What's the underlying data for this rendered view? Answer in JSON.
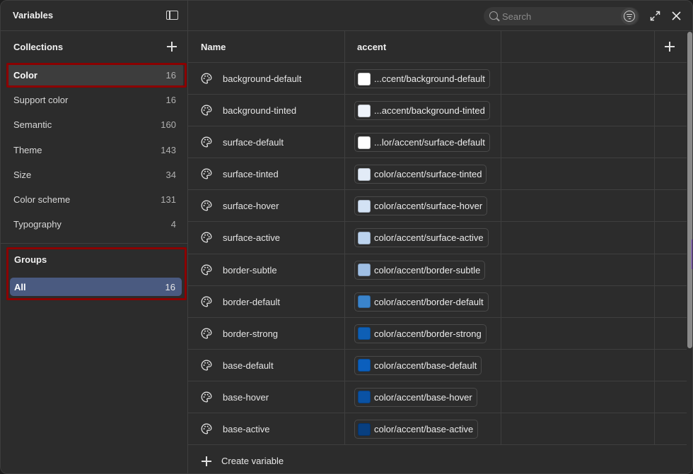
{
  "window": {
    "title": "Variables"
  },
  "sidebar": {
    "collections_heading": "Collections",
    "collections": [
      {
        "label": "Color",
        "count": "16",
        "selected": true
      },
      {
        "label": "Support color",
        "count": "16"
      },
      {
        "label": "Semantic",
        "count": "160"
      },
      {
        "label": "Theme",
        "count": "143"
      },
      {
        "label": "Size",
        "count": "34"
      },
      {
        "label": "Color scheme",
        "count": "131"
      },
      {
        "label": "Typography",
        "count": "4"
      }
    ],
    "groups_heading": "Groups",
    "groups": [
      {
        "label": "All",
        "count": "16",
        "selected": true
      }
    ]
  },
  "search": {
    "placeholder": "Search"
  },
  "table": {
    "columns": {
      "name": "Name",
      "mode": "accent"
    },
    "rows": [
      {
        "name": "background-default",
        "value": "...ccent/background-default",
        "color": "#ffffff"
      },
      {
        "name": "background-tinted",
        "value": "...accent/background-tinted",
        "color": "#eef3fa"
      },
      {
        "name": "surface-default",
        "value": "...lor/accent/surface-default",
        "color": "#ffffff"
      },
      {
        "name": "surface-tinted",
        "value": "color/accent/surface-tinted",
        "color": "#e2ebf7"
      },
      {
        "name": "surface-hover",
        "value": "color/accent/surface-hover",
        "color": "#d3e2f4"
      },
      {
        "name": "surface-active",
        "value": "color/accent/surface-active",
        "color": "#bcd3ee"
      },
      {
        "name": "border-subtle",
        "value": "color/accent/border-subtle",
        "color": "#9fbfe4"
      },
      {
        "name": "border-default",
        "value": "color/accent/border-default",
        "color": "#3a84cc"
      },
      {
        "name": "border-strong",
        "value": "color/accent/border-strong",
        "color": "#0e5fb5"
      },
      {
        "name": "base-default",
        "value": "color/accent/base-default",
        "color": "#0b5fbd"
      },
      {
        "name": "base-hover",
        "value": "color/accent/base-hover",
        "color": "#0a52a4"
      },
      {
        "name": "base-active",
        "value": "color/accent/base-active",
        "color": "#083f80"
      }
    ],
    "create_label": "Create variable"
  },
  "colors": {
    "highlight": "#8b0000",
    "group_selected": "#4a5a80",
    "background": "#2c2c2c"
  }
}
